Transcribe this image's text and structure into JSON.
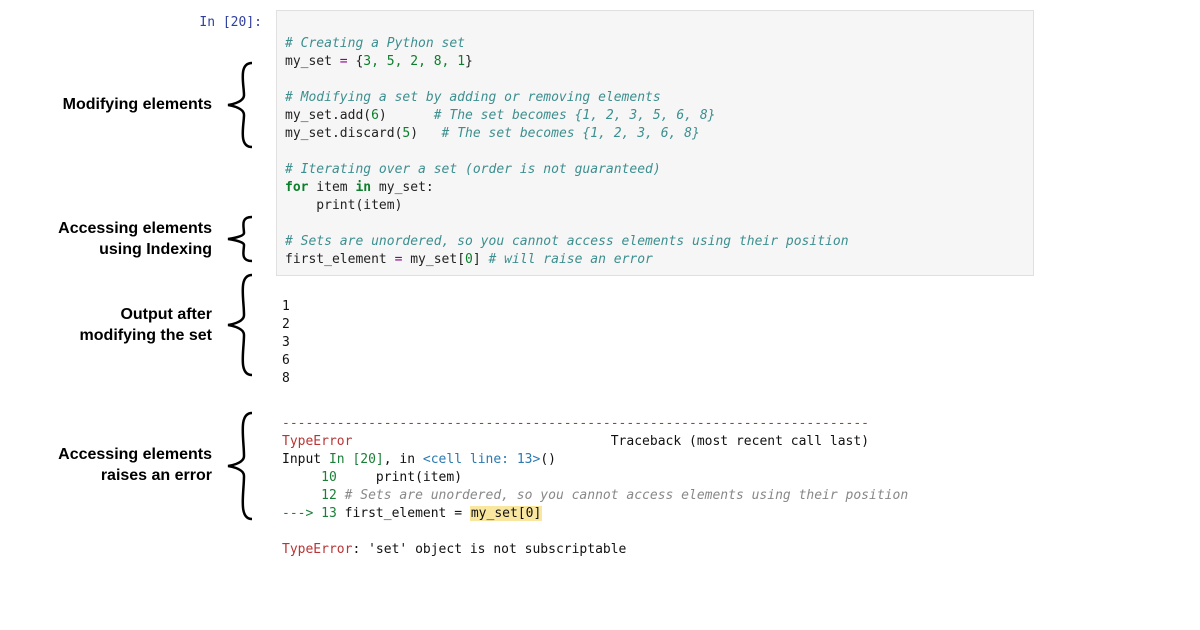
{
  "prompt": "In [20]:",
  "code": {
    "l1_comment": "# Creating a Python set",
    "l2a": "my_set ",
    "l2b": "=",
    "l2c": " {",
    "l2_nums": "3, 5, 2, 8, 1",
    "l2d": "}",
    "l4_comment": "# Modifying a set by adding or removing elements",
    "l5a": "my_set.add(",
    "l5n": "6",
    "l5b": ")      ",
    "l5c": "# The set becomes {1, 2, 3, 5, 6, 8}",
    "l6a": "my_set.discard(",
    "l6n": "5",
    "l6b": ")   ",
    "l6c": "# The set becomes {1, 2, 3, 6, 8}",
    "l8_comment": "# Iterating over a set (order is not guaranteed)",
    "l9a": "for",
    "l9b": " item ",
    "l9c": "in",
    "l9d": " my_set:",
    "l10a": "    print(item)",
    "l12_comment": "# Sets are unordered, so you cannot access elements using their position",
    "l13a": "first_element ",
    "l13b": "=",
    "l13c": " my_set[",
    "l13n": "0",
    "l13d": "] ",
    "l13e": "# will raise an error"
  },
  "output_lines": [
    "1",
    "2",
    "3",
    "6",
    "8"
  ],
  "traceback": {
    "sep": "---------------------------------------------------------------------------",
    "err_name": "TypeError",
    "tb_label": "Traceback (most recent call last)",
    "input_a": "Input ",
    "input_b": "In [20]",
    "input_c": ", in ",
    "cell": "<cell line: 13>",
    "paren": "()",
    "line10_num": "     10",
    "line10_txt": "     print(item)",
    "line12_num": "     12",
    "line12_txt": " # Sets are unordered, so you cannot access elements using their position",
    "arrow": "---> ",
    "line13_num": "13",
    "line13_a": " first_element = ",
    "line13_hl": "my_set[0]",
    "final_err": "TypeError",
    "final_msg": ": 'set' object is not subscriptable"
  },
  "annotations": {
    "modifying": "Modifying elements",
    "indexing_l1": "Accessing elements",
    "indexing_l2": "using Indexing",
    "output_l1": "Output after",
    "output_l2": "modifying the set",
    "error_l1": "Accessing elements",
    "error_l2": "raises an error"
  }
}
